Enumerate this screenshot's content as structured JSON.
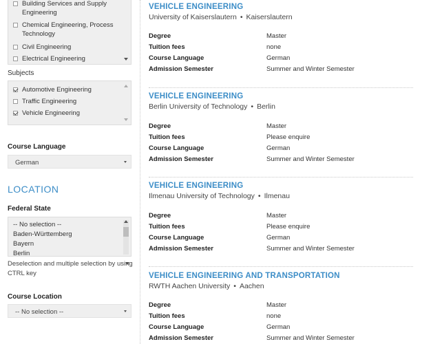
{
  "filters": {
    "fields_of_study": {
      "items": [
        {
          "label": "Building Services and Supply Engineering",
          "checked": false
        },
        {
          "label": "Chemical Engineering, Process Technology",
          "checked": false
        },
        {
          "label": "Civil Engineering",
          "checked": false
        },
        {
          "label": "Electrical Engineering",
          "checked": false
        }
      ]
    },
    "subjects": {
      "label": "Subjects",
      "items": [
        {
          "label": "Automotive Engineering",
          "checked": true
        },
        {
          "label": "Traffic Engineering",
          "checked": false
        },
        {
          "label": "Vehicle Engineering",
          "checked": true
        }
      ]
    },
    "course_language": {
      "label": "Course Language",
      "selected": "German"
    },
    "location": {
      "title": "LOCATION",
      "federal_state": {
        "label": "Federal State",
        "options": [
          "-- No selection --",
          "Baden-Württemberg",
          "Bayern",
          "Berlin"
        ],
        "help": "Deselection and multiple selection by using CTRL key"
      },
      "course_location": {
        "label": "Course Location",
        "selected": "-- No selection --"
      }
    }
  },
  "field_labels": {
    "degree": "Degree",
    "tuition": "Tuition fees",
    "language": "Course Language",
    "semester": "Admission Semester"
  },
  "separator": "•",
  "courses": [
    {
      "title": "VEHICLE ENGINEERING",
      "university": "University of Kaiserslautern",
      "city": "Kaiserslautern",
      "degree": "Master",
      "tuition": "none",
      "language": "German",
      "semester": "Summer and Winter Semester"
    },
    {
      "title": "VEHICLE ENGINEERING",
      "university": "Berlin University of Technology",
      "city": "Berlin",
      "degree": "Master",
      "tuition": "Please enquire",
      "language": "German",
      "semester": "Summer and Winter Semester"
    },
    {
      "title": "VEHICLE ENGINEERING",
      "university": "Ilmenau University of Technology",
      "city": "Ilmenau",
      "degree": "Master",
      "tuition": "Please enquire",
      "language": "German",
      "semester": "Summer and Winter Semester"
    },
    {
      "title": "VEHICLE ENGINEERING AND TRANSPORTATION",
      "university": "RWTH Aachen University",
      "city": "Aachen",
      "degree": "Master",
      "tuition": "none",
      "language": "German",
      "semester": "Summer and Winter Semester"
    }
  ],
  "colors": {
    "accent": "#3c8dc7",
    "panel_bg": "#efefef"
  }
}
